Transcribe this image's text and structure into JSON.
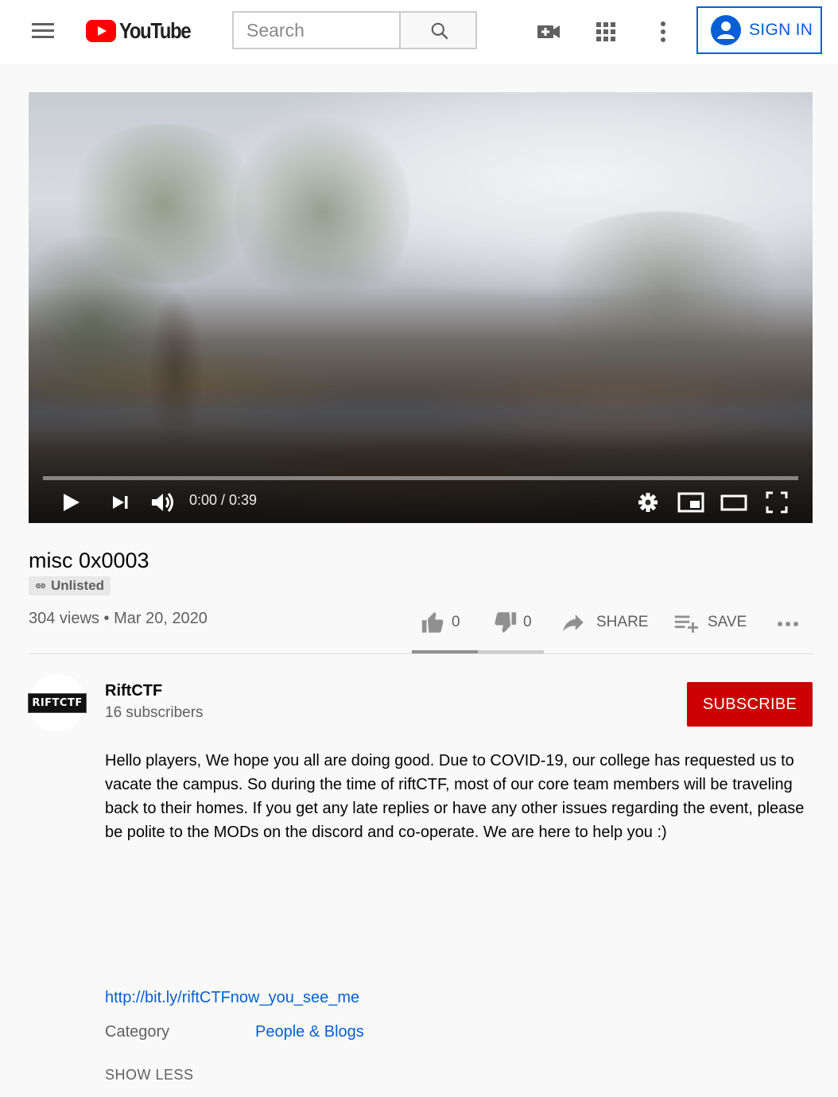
{
  "header": {
    "logo_text": "YouTube",
    "search_placeholder": "Search",
    "sign_in_label": "SIGN IN"
  },
  "player": {
    "time_display": "0:00 / 0:39",
    "progress_fraction": 0
  },
  "video": {
    "title": "misc 0x0003",
    "privacy_badge": "Unlisted",
    "views": "304 views",
    "separator": "•",
    "date": "Mar 20, 2020",
    "likes": "0",
    "dislikes": "0",
    "share_label": "SHARE",
    "save_label": "SAVE",
    "like_ratio": 0.5
  },
  "channel": {
    "name": "RiftCTF",
    "subscribers": "16 subscribers",
    "logo_text": "RIFTCTF",
    "subscribe_label": "SUBSCRIBE"
  },
  "description": {
    "text": "Hello players, We hope you all are doing good. Due to COVID-19, our college has requested us to vacate the campus. So during the time of riftCTF, most of our core team members will be traveling back to their homes. If you get any late replies or have any other issues regarding the event, please be polite to the MODs on the discord and co-operate. We are here to help you :)",
    "link": "http://bit.ly/riftCTFnow_you_see_me",
    "category_label": "Category",
    "category_value": "People & Blogs",
    "show_less_label": "SHOW LESS"
  },
  "colors": {
    "brand_red": "#ff0000",
    "subscribe_red": "#cc0000",
    "link_blue": "#065fd4",
    "secondary_text": "#606060"
  }
}
